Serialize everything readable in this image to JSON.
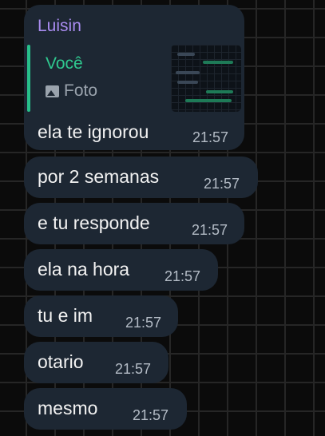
{
  "chat": {
    "sender_name": "Luisin",
    "reply": {
      "author": "Você",
      "kind": "Foto",
      "icon": "photo-icon"
    },
    "messages": [
      {
        "text": "ela te ignorou",
        "time": "21:57"
      },
      {
        "text": "por 2 semanas",
        "time": "21:57"
      },
      {
        "text": "e tu responde",
        "time": "21:57"
      },
      {
        "text": "ela na hora",
        "time": "21:57"
      },
      {
        "text": "tu e im",
        "time": "21:57"
      },
      {
        "text": "otario",
        "time": "21:57"
      },
      {
        "text": "mesmo",
        "time": "21:57"
      }
    ]
  },
  "colors": {
    "background": "#0b0b0b",
    "grid": "#262626",
    "bubble": "#1d2733",
    "sender": "#a98cf0",
    "reply_accent": "#27c08a",
    "timestamp": "#b4bcc6"
  }
}
